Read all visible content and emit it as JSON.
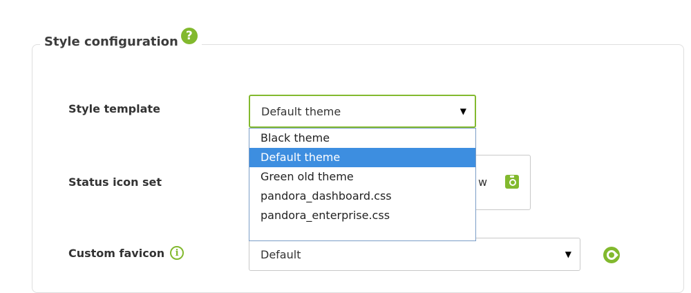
{
  "section": {
    "title": "Style configuration",
    "help_glyph": "?"
  },
  "style_template": {
    "label": "Style template",
    "selected": "Default theme",
    "caret": "▼",
    "options": [
      {
        "label": "Black theme",
        "selected": false
      },
      {
        "label": "Default theme",
        "selected": true
      },
      {
        "label": "Green old theme",
        "selected": false
      },
      {
        "label": "pandora_dashboard.css",
        "selected": false
      },
      {
        "label": "pandora_enterprise.css",
        "selected": false
      }
    ]
  },
  "status_icon_set": {
    "label": "Status icon set",
    "visible_text_fragment": "w"
  },
  "custom_favicon": {
    "label": "Custom favicon",
    "info_glyph": "i",
    "selected": "Default",
    "caret": "▼"
  },
  "colors": {
    "accent": "#82b92e",
    "dropdown_selected": "#3d8ee0",
    "border": "#c8c8c8"
  },
  "icons": {
    "help": "help-icon",
    "info": "info-icon",
    "preview": "camera-icon",
    "favicon_preview": "pandora-logo-icon"
  }
}
